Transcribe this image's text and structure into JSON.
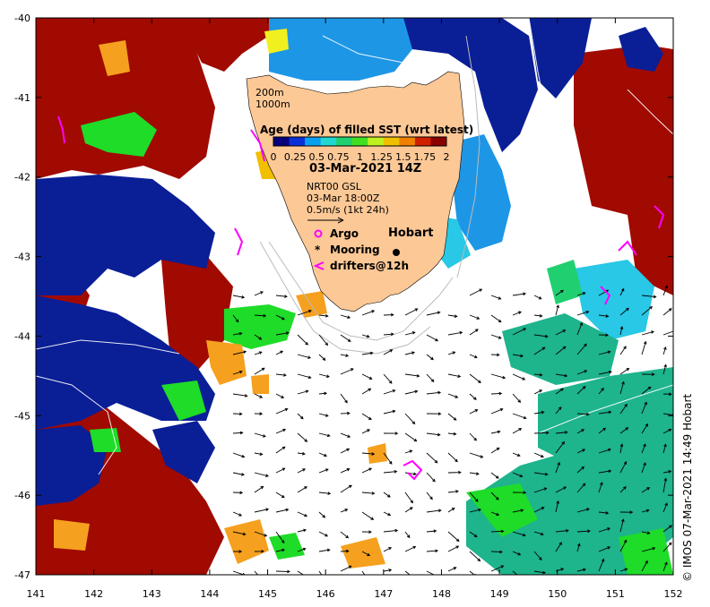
{
  "map": {
    "lon_range": [
      141,
      152
    ],
    "lat_range": [
      -47,
      -40
    ],
    "lon_ticks": [
      "141",
      "142",
      "143",
      "144",
      "145",
      "146",
      "147",
      "148",
      "149",
      "150",
      "151",
      "152"
    ],
    "lat_ticks": [
      "-40",
      "-41",
      "-42",
      "-43",
      "-44",
      "-45",
      "-46",
      "-47"
    ]
  },
  "legend": {
    "title": "Age (days) of filled SST (wrt latest)",
    "colorbar_labels": [
      "0",
      "0.25",
      "0.5",
      "0.75",
      "1",
      "1.25",
      "1.5",
      "1.75",
      "2"
    ],
    "colorbar_colors": [
      "#08007a",
      "#0a2fd8",
      "#0aa0f0",
      "#20d8d0",
      "#20d070",
      "#40e020",
      "#c0f020",
      "#f0c000",
      "#f08000",
      "#d02000",
      "#8a0000"
    ],
    "date": "03-Mar-2021 14Z",
    "current_source": "NRT00 GSL",
    "current_time": "03-Mar 18:00Z",
    "vector_scale": "0.5m/s (1kt 24h)",
    "isobaths": [
      "200m",
      "1000m"
    ],
    "argo_label": "Argo",
    "mooring_label": "Mooring",
    "drifters_label": "drifters@12h"
  },
  "places": {
    "hobart": "Hobart"
  },
  "credit": "© IMOS 07-Mar-2021 14:49 Hobart",
  "colors": {
    "land": "#fcc896",
    "navy": "#0a1e96",
    "darkred": "#a00a00",
    "orange": "#f5a01e",
    "green": "#1edc28",
    "teal": "#1eb48c",
    "cyan": "#28c8e6",
    "lightblue": "#1e96e6",
    "drifter": "#ff00ff"
  }
}
